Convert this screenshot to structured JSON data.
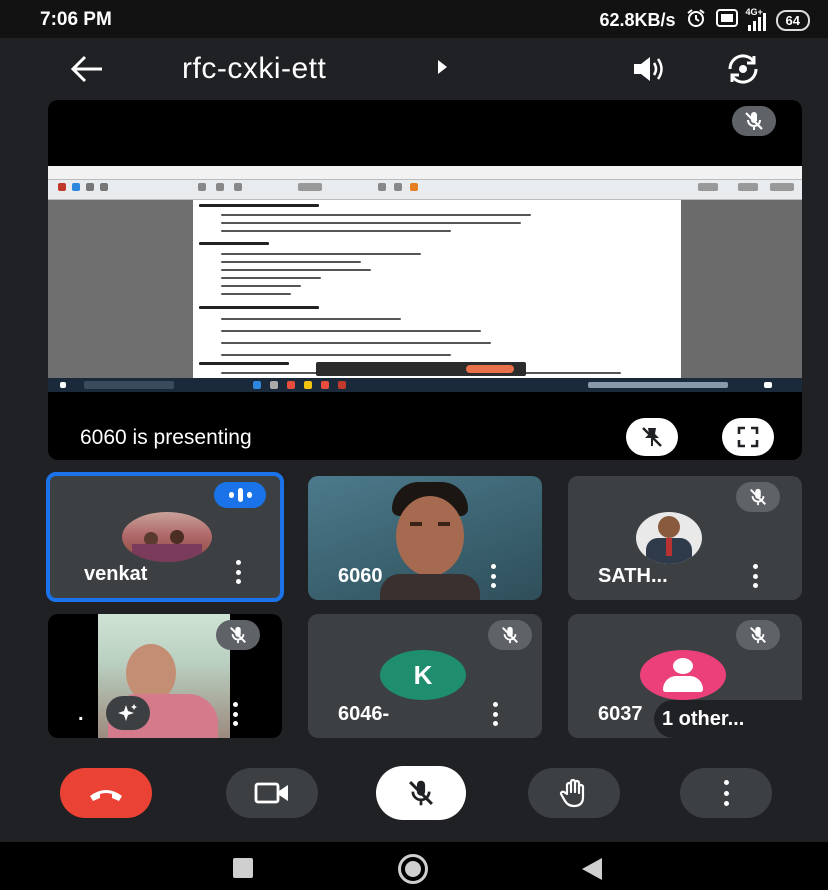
{
  "status_bar": {
    "time": "7:06 PM",
    "data_rate": "62.8KB/s",
    "network": "4G+",
    "battery": "64"
  },
  "top_bar": {
    "meeting_code": "rfc-cxki-ett",
    "icons": [
      "back-arrow-icon",
      "caret-right-icon",
      "speaker-icon",
      "switch-camera-icon"
    ]
  },
  "presentation": {
    "presenting_text": "6060 is presenting",
    "icons": [
      "mic-off-icon",
      "unpin-icon",
      "fullscreen-icon"
    ]
  },
  "participants": [
    {
      "name": "venkat",
      "state": "speaking",
      "active_border": "#1a73e8"
    },
    {
      "name": "6060",
      "state": "video"
    },
    {
      "name": "SATH...",
      "state": "muted"
    },
    {
      "name": ".",
      "state": "muted"
    },
    {
      "name": "6046-",
      "state": "muted",
      "initial": "K",
      "avatar_color": "#1e8e6e"
    },
    {
      "name": "6037",
      "extra": "1 other...",
      "state": "muted",
      "avatar_color": "#ec407a"
    }
  ],
  "controls": {
    "items": [
      "end-call",
      "camera",
      "microphone-off",
      "raise-hand",
      "more-options"
    ],
    "end_call_color": "#ea4335"
  },
  "nav_bar": {
    "items": [
      "recents",
      "home",
      "back"
    ]
  }
}
